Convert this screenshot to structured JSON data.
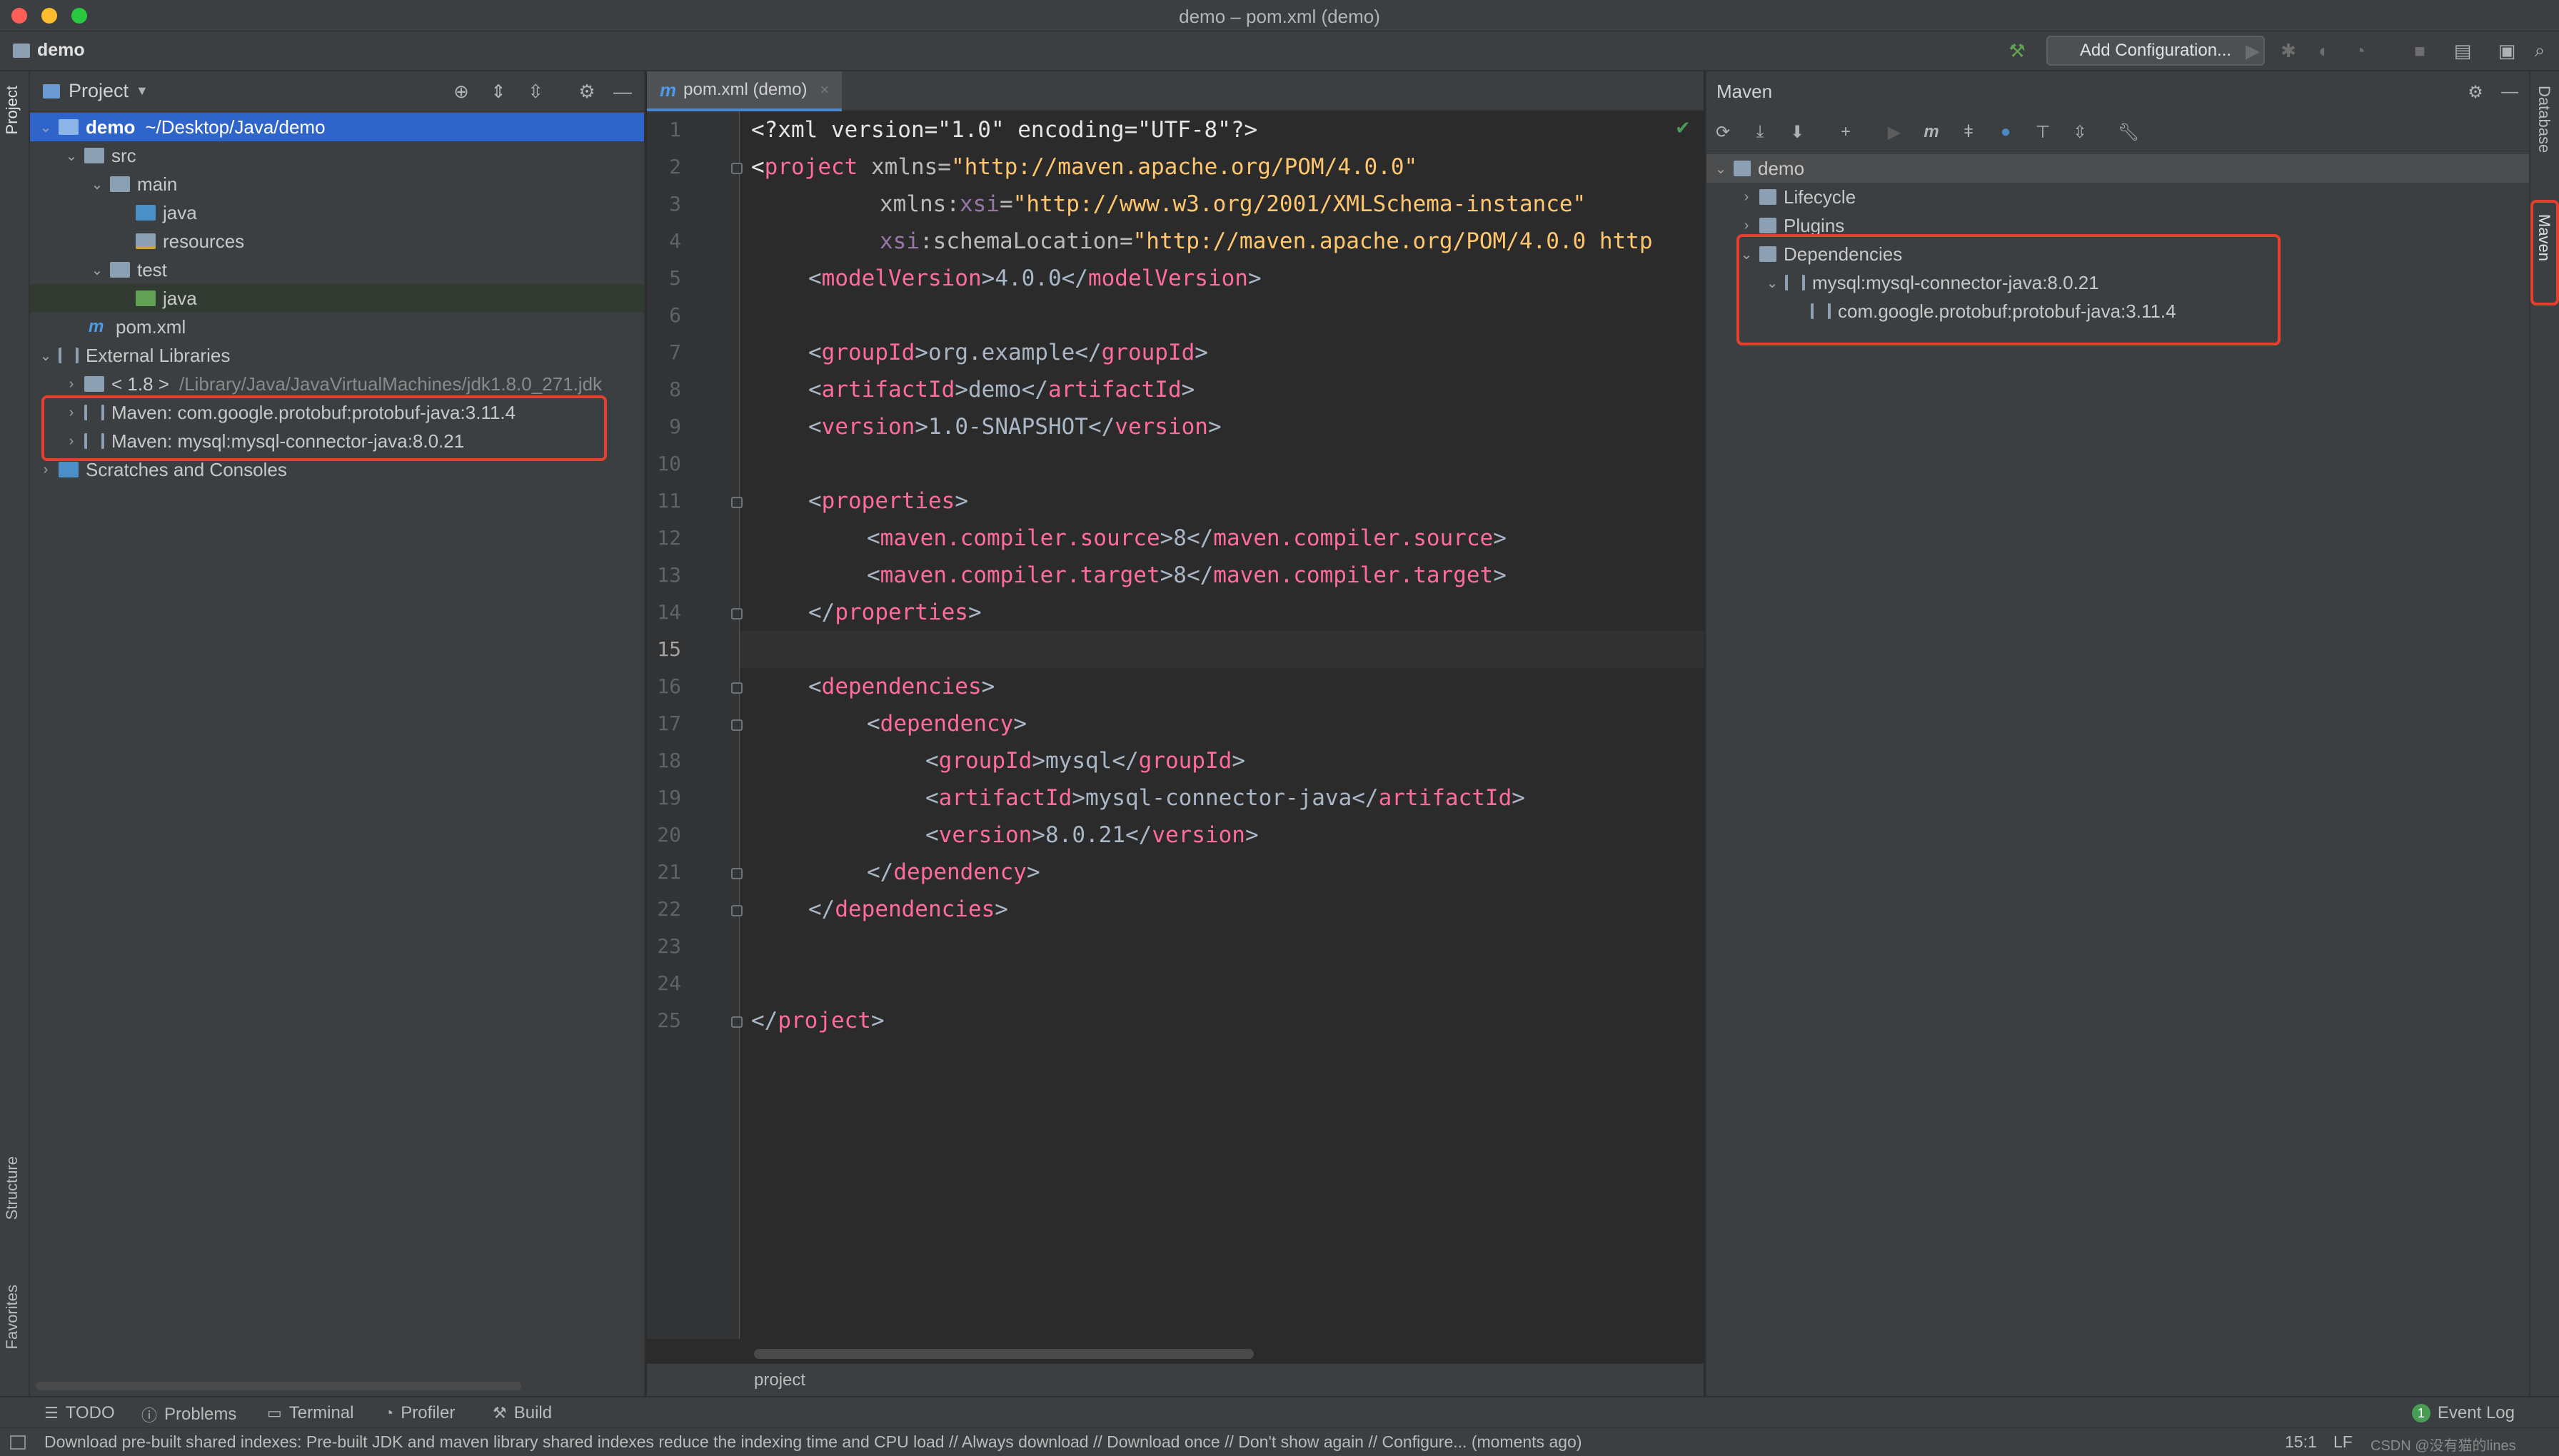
{
  "window": {
    "title": "demo – pom.xml (demo)"
  },
  "navbar": {
    "project": "demo",
    "add_configuration": "Add Configuration..."
  },
  "left_stripe": {
    "project": "Project",
    "structure": "Structure",
    "favorites": "Favorites"
  },
  "right_stripe": {
    "database": "Database",
    "maven": "Maven"
  },
  "project_panel": {
    "title": "Project",
    "tree": {
      "root_name": "demo",
      "root_path": "~/Desktop/Java/demo",
      "src": "src",
      "main": "main",
      "main_java": "java",
      "resources": "resources",
      "test": "test",
      "test_java": "java",
      "pom": "pom.xml",
      "external_libraries": "External Libraries",
      "jdk_name": "< 1.8 >",
      "jdk_path": "/Library/Java/JavaVirtualMachines/jdk1.8.0_271.jdk",
      "lib_protobuf": "Maven: com.google.protobuf:protobuf-java:3.11.4",
      "lib_mysql": "Maven: mysql:mysql-connector-java:8.0.21",
      "scratches": "Scratches and Consoles"
    }
  },
  "editor": {
    "tab_label": "pom.xml (demo)",
    "current_line": 15,
    "line_numbers": [
      "1",
      "2",
      "3",
      "4",
      "5",
      "6",
      "7",
      "8",
      "9",
      "10",
      "11",
      "12",
      "13",
      "14",
      "15",
      "16",
      "17",
      "18",
      "19",
      "20",
      "21",
      "22",
      "23",
      "24",
      "25"
    ],
    "code": {
      "l1_prolog": "<?xml version=\"1.0\" encoding=\"UTF-8\"?>",
      "l2_open": "<",
      "l2_tag": "project",
      "l2_attr": " xmlns=",
      "l2_val": "\"http://maven.apache.org/POM/4.0.0\"",
      "l3_ns": "xmlns:",
      "l3_attr": "xsi",
      "l3_eq": "=",
      "l3_val": "\"http://www.w3.org/2001/XMLSchema-instance\"",
      "l4_ns": "xsi",
      "l4_attr": ":schemaLocation=",
      "l4_val": "\"http://maven.apache.org/POM/4.0.0 http",
      "model_version_tag": "modelVersion",
      "model_version": "4.0.0",
      "group_id_tag": "groupId",
      "group_id": "org.example",
      "artifact_id_tag": "artifactId",
      "artifact_id": "demo",
      "version_tag": "version",
      "version": "1.0-SNAPSHOT",
      "properties_tag": "properties",
      "compiler_source_tag": "maven.compiler.source",
      "compiler_source": "8",
      "compiler_target_tag": "maven.compiler.target",
      "compiler_target": "8",
      "dependencies_tag": "dependencies",
      "dependency_tag": "dependency",
      "dep_group_id": "mysql",
      "dep_artifact_id": "mysql-connector-java",
      "dep_version": "8.0.21",
      "project_close_tag": "project"
    },
    "breadcrumb": "project"
  },
  "maven_panel": {
    "title": "Maven",
    "tree": {
      "root": "demo",
      "lifecycle": "Lifecycle",
      "plugins": "Plugins",
      "dependencies": "Dependencies",
      "dep_mysql": "mysql:mysql-connector-java:8.0.21",
      "dep_protobuf": "com.google.protobuf:protobuf-java:3.11.4"
    }
  },
  "bottom_bar": {
    "todo": "TODO",
    "problems": "Problems",
    "terminal": "Terminal",
    "profiler": "Profiler",
    "build": "Build",
    "event_log": "Event Log",
    "event_count": "1"
  },
  "status_bar": {
    "message": "Download pre-built shared indexes: Pre-built JDK and maven library shared indexes reduce the indexing time and CPU load // Always download // Download once // Don't show again // Configure... (moments ago)",
    "position": "15:1",
    "line_sep": "LF",
    "extra": "CSDN @没有猫的lines"
  },
  "colors": {
    "selection": "#2f65ca",
    "highlight_box": "#e5402f",
    "xml_tag": "#ff6b9e",
    "xml_string": "#ffc66d"
  }
}
